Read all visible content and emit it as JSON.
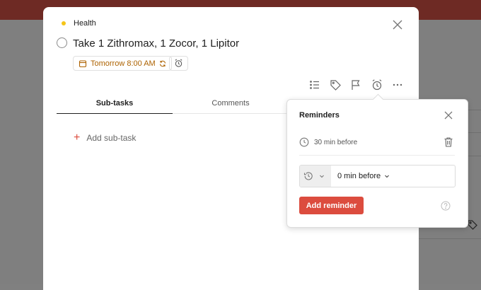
{
  "task": {
    "project": "Health",
    "project_color": "#f5c518",
    "title": "Take 1 Zithromax, 1 Zocor, 1 Lipitor",
    "due_label": "Tomorrow 8:00 AM",
    "due_icon": "calendar-icon",
    "recurring_icon": "repeat-icon",
    "reminder_chip_icon": "alarm-icon"
  },
  "toolbar": {
    "icons": [
      "list-icon",
      "tag-icon",
      "flag-icon",
      "alarm-icon",
      "more-icon"
    ]
  },
  "tabs": [
    {
      "label": "Sub-tasks",
      "active": true
    },
    {
      "label": "Comments",
      "active": false
    }
  ],
  "subtasks": {
    "add_label": "Add sub-task",
    "accent_color": "#dc4c3e"
  },
  "reminders_popover": {
    "title": "Reminders",
    "existing": [
      {
        "label": "30 min before"
      }
    ],
    "new_reminder": {
      "type_icon": "history-icon",
      "value": "0 min before"
    },
    "add_button": "Add reminder",
    "button_color": "#dc4c3e"
  }
}
